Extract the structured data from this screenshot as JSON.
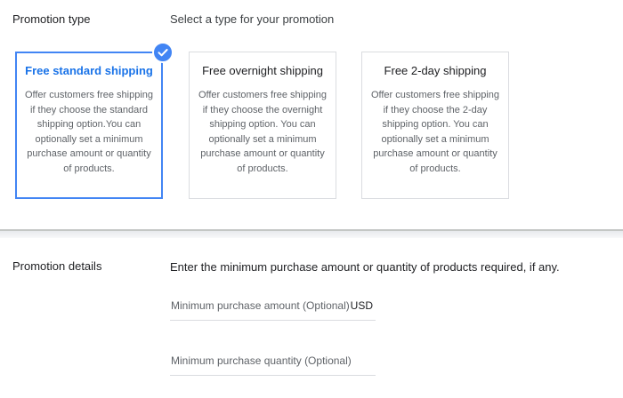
{
  "promotion_type": {
    "label": "Promotion type",
    "description": "Select a type for your promotion",
    "cards": [
      {
        "title": "Free standard shipping",
        "body": "Offer customers free shipping if they choose the standard shipping option.You can optionally set a minimum purchase amount or quantity of products.",
        "selected": true
      },
      {
        "title": "Free overnight shipping",
        "body": "Offer customers free shipping if they choose the overnight shipping option. You can optionally set a minimum purchase amount or quantity of products.",
        "selected": false
      },
      {
        "title": "Free 2-day shipping",
        "body": "Offer customers free shipping if they choose the 2-day shipping option. You can optionally set a minimum purchase amount or quantity of products.",
        "selected": false
      }
    ],
    "selected_icon": "check-circle-icon"
  },
  "promotion_details": {
    "label": "Promotion details",
    "description": "Enter the minimum purchase amount or quantity of products required, if any.",
    "min_amount": {
      "placeholder": "Minimum purchase amount (Optional)",
      "value": "",
      "currency": "USD"
    },
    "min_quantity": {
      "placeholder": "Minimum purchase quantity (Optional)",
      "value": ""
    }
  },
  "colors": {
    "accent": "#1a73e8",
    "selected_border": "#4285f4",
    "card_border": "#dadce0",
    "muted_text": "#5f6368"
  }
}
